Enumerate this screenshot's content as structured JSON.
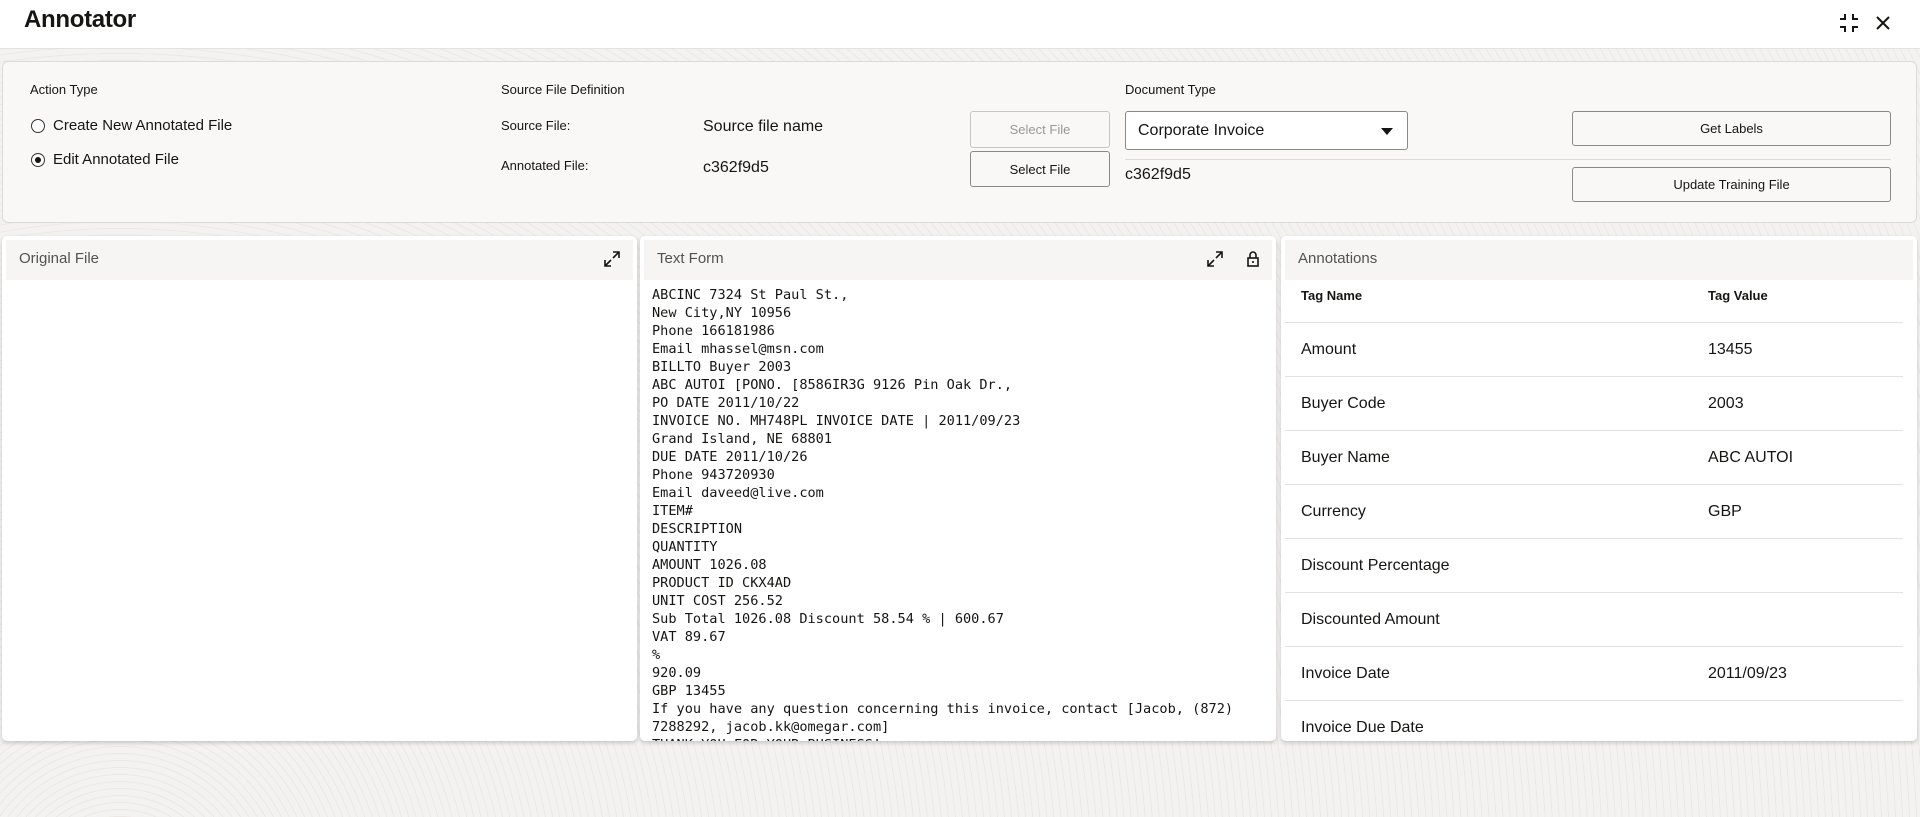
{
  "app": {
    "title": "Annotator",
    "icons": [
      "collapse-icon",
      "close-icon"
    ]
  },
  "action_type": {
    "label": "Action Type",
    "options": [
      {
        "label": "Create New Annotated File",
        "selected": false
      },
      {
        "label": "Edit Annotated File",
        "selected": true
      }
    ]
  },
  "source": {
    "label": "Source File Definition",
    "source_file_label": "Source File:",
    "source_file_value": "Source file name",
    "annotated_file_label": "Annotated File:",
    "annotated_file_value": "c362f9d5",
    "select_file": "Select File",
    "select_file_2": "Select File"
  },
  "document_type": {
    "label": "Document Type",
    "value": "Corporate Invoice",
    "file": "c362f9d5"
  },
  "actions": {
    "get_labels": "Get Labels",
    "update_training": "Update Training File"
  },
  "original_file": {
    "title": "Original File"
  },
  "text_form": {
    "title": "Text Form",
    "content": "ABCINC 7324 St Paul St.,\nNew City,NY 10956\nPhone 166181986\nEmail mhassel@msn.com\nBILLTO Buyer 2003\nABC AUTOI [PONO. [8586IR3G 9126 Pin Oak Dr.,\nPO DATE 2011/10/22\nINVOICE NO. MH748PL INVOICE DATE | 2011/09/23\nGrand Island, NE 68801\nDUE DATE 2011/10/26\nPhone 943720930\nEmail daveed@live.com\nITEM#\nDESCRIPTION\nQUANTITY\nAMOUNT 1026.08\nPRODUCT ID CKX4AD\nUNIT COST 256.52\nSub Total 1026.08 Discount 58.54 % | 600.67\nVAT 89.67\n%\n920.09\nGBP 13455\nIf you have any question concerning this invoice, contact [Jacob, (872)\n7288292, jacob.kk@omegar.com]\nTHANK YOU FOR YOUR BUSINESS!"
  },
  "annotations": {
    "title": "Annotations",
    "columns": [
      "Tag Name",
      "Tag Value"
    ],
    "rows": [
      [
        "Amount",
        "13455"
      ],
      [
        "Buyer Code",
        "2003"
      ],
      [
        "Buyer Name",
        "ABC AUTOI"
      ],
      [
        "Currency",
        "GBP"
      ],
      [
        "Discount Percentage",
        ""
      ],
      [
        "Discounted Amount",
        ""
      ],
      [
        "Invoice Date",
        "2011/09/23"
      ],
      [
        "Invoice Due Date",
        ""
      ]
    ]
  }
}
